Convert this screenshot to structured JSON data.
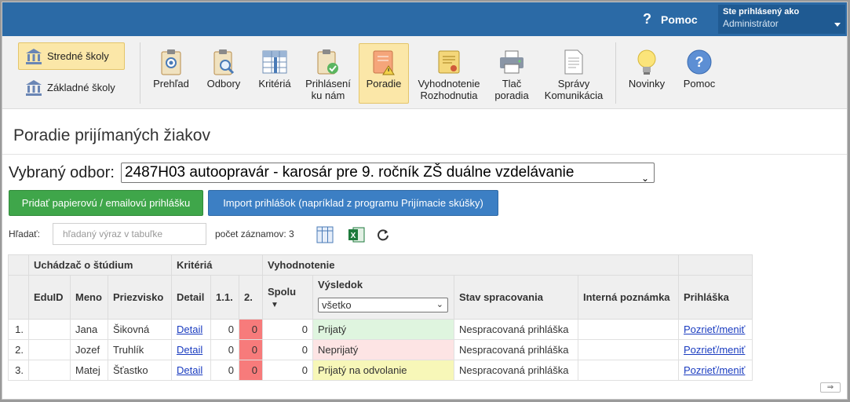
{
  "topbar": {
    "help_label": "Pomoc",
    "help_icon": "question-icon",
    "user_line1": "Ste prihlásený ako",
    "user_line2": "Administrátor",
    "color": "#2b6aa6"
  },
  "schools": [
    {
      "label": "Stredné školy",
      "icon": "bank-icon",
      "active": true
    },
    {
      "label": "Základné školy",
      "icon": "bank-icon",
      "active": false
    }
  ],
  "toolbar": {
    "prehlad": "Prehľad",
    "odbory": "Odbory",
    "kriteria": "Kritériá",
    "prihlasenie_1": "Prihlásení",
    "prihlasenie_2": "ku nám",
    "poradie": "Poradie",
    "vyhodnotenie_1": "Vyhodnotenie",
    "vyhodnotenie_2": "Rozhodnutia",
    "tlac_1": "Tlač",
    "tlac_2": "poradia",
    "spravy_1": "Správy",
    "spravy_2": "Komunikácia",
    "novinky": "Novinky",
    "pomoc": "Pomoc",
    "active_color": "#fbe7a8"
  },
  "page": {
    "title": "Poradie prijímaných žiakov",
    "odbor_label": "Vybraný odbor:",
    "odbor_value": "2487H03 autoopravár - karosár pre 9. ročník ZŠ duálne vzdelávanie",
    "btn_add": "Pridať papierovú / emailovú prihlášku",
    "btn_import": "Import prihlášok (napríklad z programu Prijímacie skúšky)",
    "search_label": "Hľadať:",
    "search_placeholder": "hľadaný výraz v tabuľke",
    "count_text": "počet záznamov: 3"
  },
  "table": {
    "groups": {
      "uchadzac": "Uchádzač o štúdium",
      "kriteria": "Kritériá",
      "vyhodnotenie": "Vyhodnotenie"
    },
    "headers": {
      "eduid": "EduID",
      "meno": "Meno",
      "priezvisko": "Priezvisko",
      "detail": "Detail",
      "k1": "1.1.",
      "k2": "2.",
      "spolu": "Spolu",
      "vysledok": "Výsledok",
      "stav": "Stav spracovania",
      "poznamka": "Interná poznámka",
      "prihlaska": "Prihláška"
    },
    "filter_value": "všetko",
    "rows": [
      {
        "n": "1.",
        "eduid": "",
        "meno": "Jana",
        "priezvisko": "Šikovná",
        "detail": "Detail",
        "k1": "0",
        "k2": "0",
        "spolu": "0",
        "vysledok": "Prijatý",
        "stav": "Nespracovaná prihláška",
        "poznamka": "",
        "prihlaska": "Pozrieť/meniť"
      },
      {
        "n": "2.",
        "eduid": "",
        "meno": "Jozef",
        "priezvisko": "Truhlík",
        "detail": "Detail",
        "k1": "0",
        "k2": "0",
        "spolu": "0",
        "vysledok": "Neprijatý",
        "stav": "Nespracovaná prihláška",
        "poznamka": "",
        "prihlaska": "Pozrieť/meniť"
      },
      {
        "n": "3.",
        "eduid": "",
        "meno": "Matej",
        "priezvisko": "Šťastko",
        "detail": "Detail",
        "k1": "0",
        "k2": "0",
        "spolu": "0",
        "vysledok": "Prijatý na odvolanie",
        "stav": "Nespracovaná prihláška",
        "poznamka": "",
        "prihlaska": "Pozrieť/meniť"
      }
    ]
  }
}
